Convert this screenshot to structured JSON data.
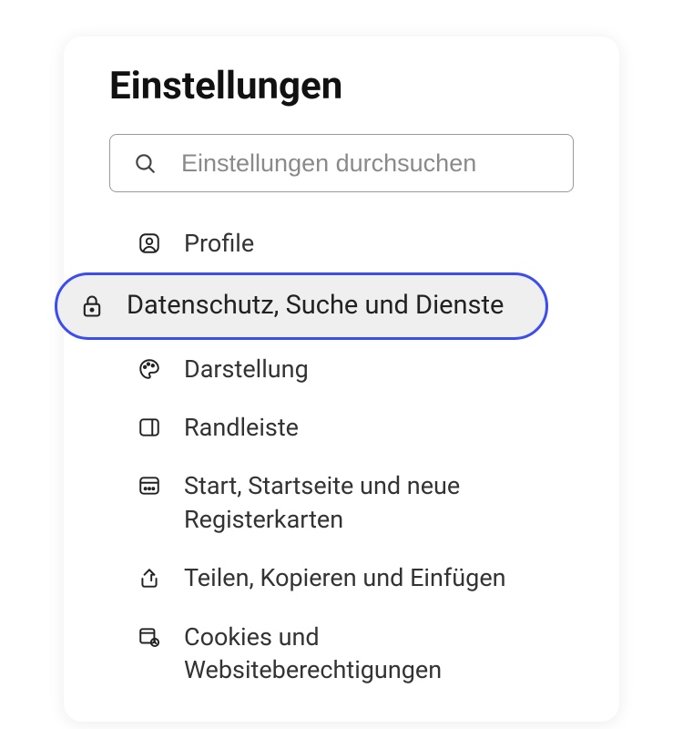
{
  "title": "Einstellungen",
  "search": {
    "placeholder": "Einstellungen durchsuchen"
  },
  "nav": {
    "items": [
      {
        "id": "profiles",
        "label": "Profile",
        "icon": "profile-icon",
        "selected": false
      },
      {
        "id": "privacy",
        "label": "Datenschutz, Suche und Dienste",
        "icon": "lock-icon",
        "selected": true
      },
      {
        "id": "appearance",
        "label": "Darstellung",
        "icon": "palette-icon",
        "selected": false
      },
      {
        "id": "sidebar",
        "label": "Randleiste",
        "icon": "sidebar-panel-icon",
        "selected": false
      },
      {
        "id": "start",
        "label": "Start, Startseite und neue Registerkarten",
        "icon": "home-tab-icon",
        "selected": false
      },
      {
        "id": "share",
        "label": "Teilen, Kopieren und Einfügen",
        "icon": "share-icon",
        "selected": false
      },
      {
        "id": "cookies",
        "label": "Cookies und Websiteberechtigungen",
        "icon": "cookies-permissions-icon",
        "selected": false
      }
    ]
  },
  "colors": {
    "selection_outline": "#3b4cf0",
    "selection_bg": "#efefef"
  }
}
